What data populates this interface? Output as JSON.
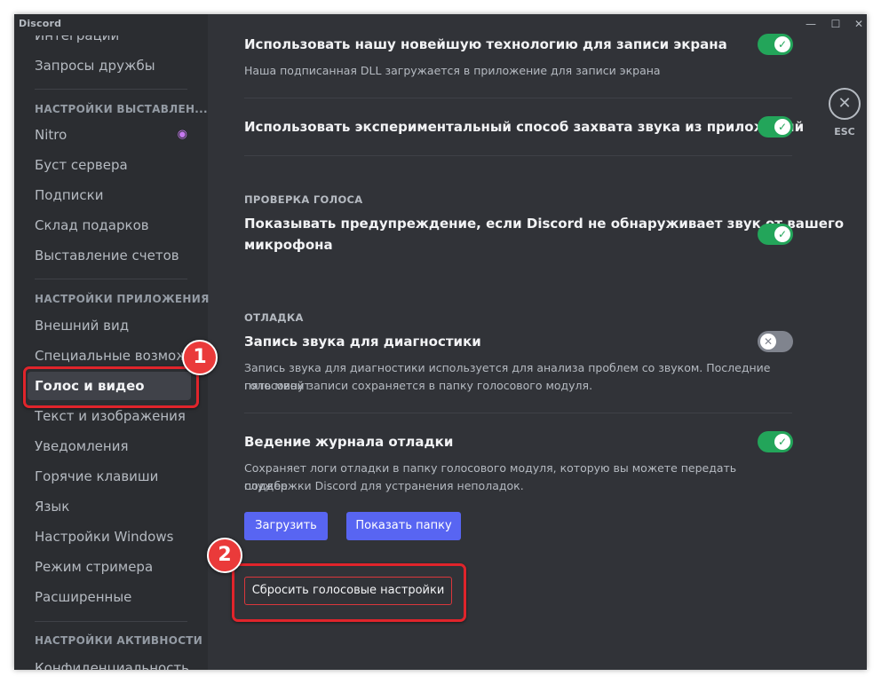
{
  "window": {
    "app_title": "Discord",
    "minimize": "—",
    "maximize": "☐",
    "close": "✕"
  },
  "sidebar": {
    "items_top": [
      "Интеграции",
      "Запросы дружбы"
    ],
    "billing_header": "НАСТРОЙКИ ВЫСТАВЛЕН...",
    "billing_items": [
      "Nitro",
      "Буст сервера",
      "Подписки",
      "Склад подарков",
      "Выставление счетов"
    ],
    "app_header": "НАСТРОЙКИ ПРИЛОЖЕНИЯ",
    "app_items": [
      "Внешний вид",
      "Специальные возмож...",
      "Голос и видео",
      "Текст и изображения",
      "Уведомления",
      "Горячие клавиши",
      "Язык",
      "Настройки Windows",
      "Режим стримера",
      "Расширенные"
    ],
    "active_item": "Голос и видео",
    "activity_header": "НАСТРОЙКИ АКТИВНОСТИ",
    "activity_items": [
      "Конфиденциальность"
    ]
  },
  "content": {
    "new_tech_title": "Использовать нашу новейшую технологию для записи экрана",
    "new_tech_desc": "Наша подписанная DLL загружается в приложение для записи экрана",
    "new_tech_enabled": true,
    "experimental_title": "Использовать экспериментальный способ захвата звука из приложений",
    "experimental_enabled": true,
    "voice_check_header": "ПРОВЕРКА ГОЛОСА",
    "warning_title_line1": "Показывать предупреждение, если Discord не обнаруживает звук от вашего",
    "warning_title_line2": "микрофона",
    "warning_enabled": true,
    "debug_header": "ОТЛАДКА",
    "diag_title": "Запись звука для диагностики",
    "diag_desc_line1": "Запись звука для диагностики используется для анализа проблем со звуком. Последние пять минут",
    "diag_desc_line2": "голосовой записи сохраняется в папку голосового модуля.",
    "diag_enabled": false,
    "debug_log_title": "Ведение журнала отладки",
    "debug_log_desc_line1": "Сохраняет логи отладки в папку голосового модуля, которую вы можете передать службе",
    "debug_log_desc_line2": "поддержки Discord для устранения неполадок.",
    "debug_log_enabled": true,
    "upload_button": "Загрузить",
    "show_folder_button": "Показать папку",
    "reset_button": "Сбросить голосовые настройки"
  },
  "esc": {
    "icon": "✕",
    "label": "ESC"
  },
  "annotations": {
    "marker_1": "1",
    "marker_2": "2",
    "highlight_color": "#e0242b"
  },
  "colors": {
    "toggle_on": "#23a55a",
    "toggle_off": "#80848e",
    "brand": "#5865f2",
    "danger": "#da373c"
  }
}
